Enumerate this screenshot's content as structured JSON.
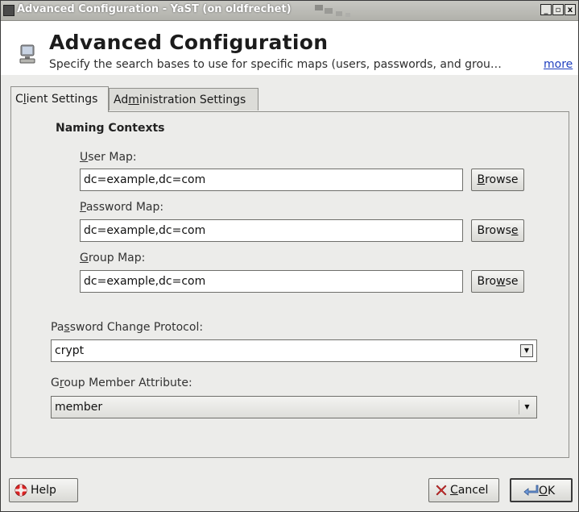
{
  "window": {
    "title": "Advanced Configuration - YaST (on oldfrechet)",
    "controls": [
      "_",
      "▫",
      "x"
    ]
  },
  "header": {
    "title": "Advanced Configuration",
    "description": "Specify the search bases to use for specific maps (users, passwords, and grou…",
    "more_link": "more"
  },
  "tabs": [
    {
      "label_pre": "C",
      "label_mn": "l",
      "label_post": "ient Settings",
      "active": true
    },
    {
      "label_pre": "Ad",
      "label_mn": "m",
      "label_post": "inistration Settings",
      "active": false
    }
  ],
  "naming": {
    "section_title": "Naming Contexts",
    "user_map": {
      "label_mn": "U",
      "label_rest": "ser Map:",
      "value": "dc=example,dc=com",
      "browse_pre": "",
      "browse_mn": "B",
      "browse_post": "rowse"
    },
    "password_map": {
      "label_mn": "P",
      "label_rest": "assword Map:",
      "value": "dc=example,dc=com",
      "browse_pre": "Brows",
      "browse_mn": "e",
      "browse_post": ""
    },
    "group_map": {
      "label_mn": "G",
      "label_rest": "roup Map:",
      "value": "dc=example,dc=com",
      "browse_pre": "Bro",
      "browse_mn": "w",
      "browse_post": "se"
    }
  },
  "password_protocol": {
    "label_pre": "Pa",
    "label_mn": "s",
    "label_post": "sword Change Protocol:",
    "value": "crypt"
  },
  "group_member_attr": {
    "label_pre": "G",
    "label_mn": "r",
    "label_post": "oup Member Attribute:",
    "value": "member"
  },
  "footer": {
    "help": "Help",
    "cancel_mn": "C",
    "cancel_rest": "ancel",
    "ok_mn": "O",
    "ok_rest": "K"
  },
  "colors": {
    "link": "#1f3fbf",
    "titlebar": "#b9b9b4",
    "panel": "#ececea"
  }
}
